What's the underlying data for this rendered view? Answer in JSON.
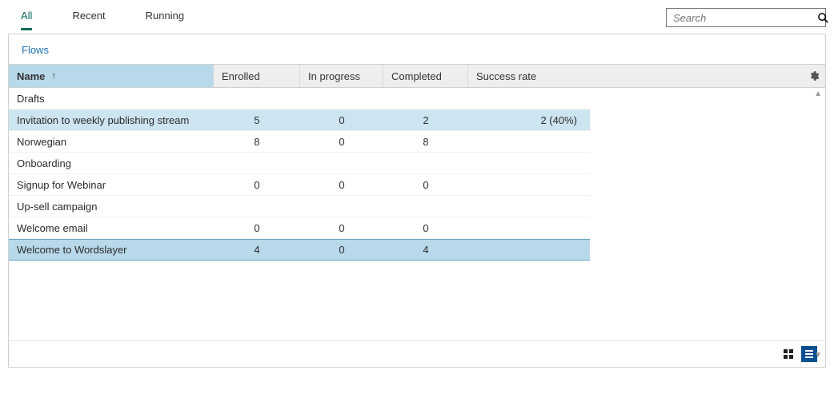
{
  "tabs": {
    "all": "All",
    "recent": "Recent",
    "running": "Running",
    "active": "all"
  },
  "search": {
    "placeholder": "Search"
  },
  "panel": {
    "title": "Flows"
  },
  "columns": {
    "name": "Name",
    "enrolled": "Enrolled",
    "inprogress": "In progress",
    "completed": "Completed",
    "success": "Success rate",
    "sort_indicator": "↑"
  },
  "rows": [
    {
      "name": "Drafts",
      "enrolled": "",
      "inprogress": "",
      "completed": "",
      "success": "",
      "state": ""
    },
    {
      "name": "Invitation to weekly publishing stream",
      "enrolled": "5",
      "inprogress": "0",
      "completed": "2",
      "success": "2 (40%)",
      "state": "highlight"
    },
    {
      "name": "Norwegian",
      "enrolled": "8",
      "inprogress": "0",
      "completed": "8",
      "success": "",
      "state": ""
    },
    {
      "name": "Onboarding",
      "enrolled": "",
      "inprogress": "",
      "completed": "",
      "success": "",
      "state": ""
    },
    {
      "name": "Signup for Webinar",
      "enrolled": "0",
      "inprogress": "0",
      "completed": "0",
      "success": "",
      "state": ""
    },
    {
      "name": "Up-sell campaign",
      "enrolled": "",
      "inprogress": "",
      "completed": "",
      "success": "",
      "state": ""
    },
    {
      "name": "Welcome email",
      "enrolled": "0",
      "inprogress": "0",
      "completed": "0",
      "success": "",
      "state": ""
    },
    {
      "name": "Welcome to Wordslayer",
      "enrolled": "4",
      "inprogress": "0",
      "completed": "4",
      "success": "",
      "state": "selected"
    }
  ]
}
